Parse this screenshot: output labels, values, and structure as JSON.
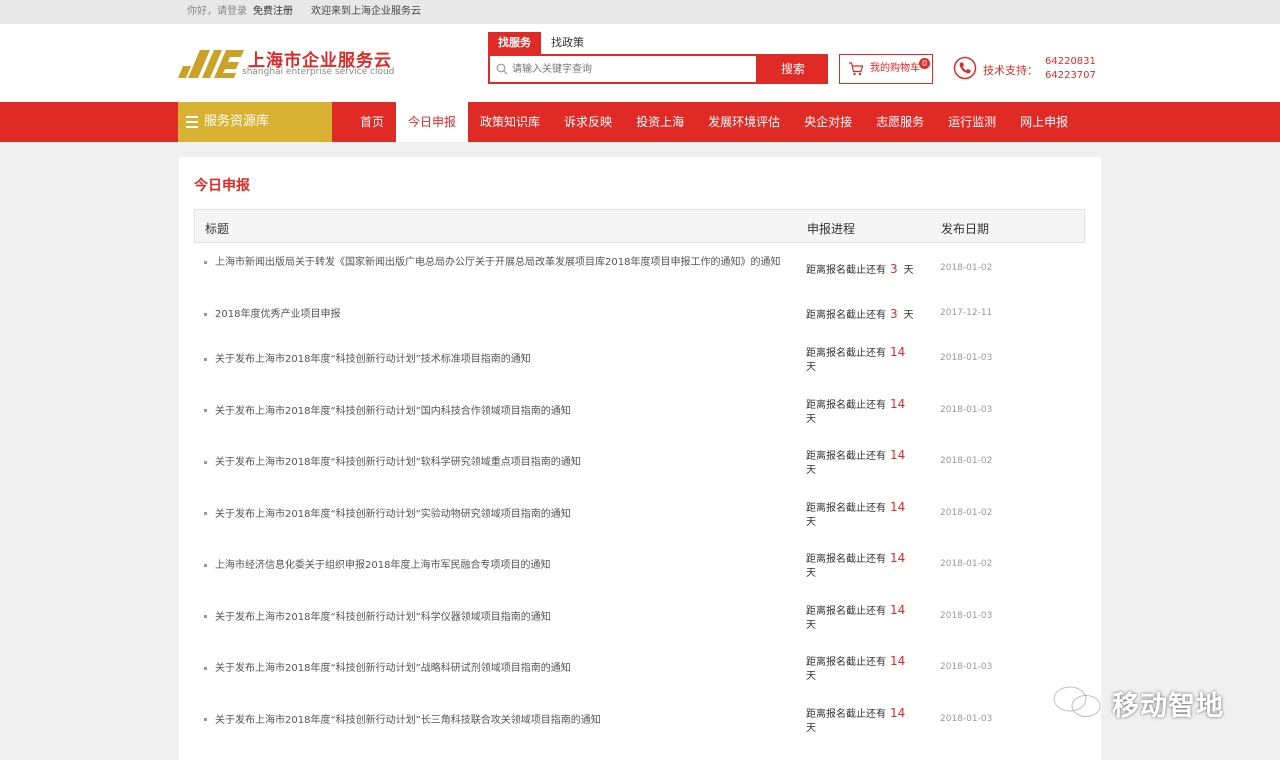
{
  "topbar": {
    "greeting": "你好，请登录",
    "register": "免费注册",
    "welcome": "欢迎来到上海企业服务云"
  },
  "header": {
    "logo_title": "上海市企业服务云",
    "logo_sub": "shanghai enterprise service cloud",
    "search_tabs": [
      "找服务",
      "找政策"
    ],
    "search_placeholder": "请输入关键字查询",
    "search_button": "搜索",
    "cart_label": "我的购物车",
    "cart_count": "0",
    "support_label": "技术支持：",
    "phones": [
      "64220831",
      "64223707"
    ]
  },
  "nav": {
    "resource_label": "服务资源库",
    "items": [
      "首页",
      "今日申报",
      "政策知识库",
      "诉求反映",
      "投资上海",
      "发展环境评估",
      "央企对接",
      "志愿服务",
      "运行监测",
      "网上申报"
    ],
    "active": "今日申报"
  },
  "main": {
    "page_title": "今日申报",
    "columns": [
      "标题",
      "申报进程",
      "发布日期"
    ],
    "rows": [
      {
        "title": "上海市新闻出版局关于转发《国家新闻出版广电总局办公厅关于开展总局改革发展项目库2018年度项目申报工作的通知》的通知",
        "prog_prefix": "距离报名截止还有",
        "days": "3",
        "unit": "天",
        "date": "2018-01-02"
      },
      {
        "title": "2018年度优秀产业项目申报",
        "prog_prefix": "距离报名截止还有",
        "days": "3",
        "unit": "天",
        "date": "2017-12-11"
      },
      {
        "title": "关于发布上海市2018年度“科技创新行动计划”技术标准项目指南的通知",
        "prog_prefix": "距离报名截止还有",
        "days": "14",
        "unit": "天",
        "date": "2018-01-03"
      },
      {
        "title": "关于发布上海市2018年度“科技创新行动计划”国内科技合作领域项目指南的通知",
        "prog_prefix": "距离报名截止还有",
        "days": "14",
        "unit": "天",
        "date": "2018-01-03"
      },
      {
        "title": "关于发布上海市2018年度“科技创新行动计划”软科学研究领域重点项目指南的通知",
        "prog_prefix": "距离报名截止还有",
        "days": "14",
        "unit": "天",
        "date": "2018-01-02"
      },
      {
        "title": "关于发布上海市2018年度“科技创新行动计划”实验动物研究领域项目指南的通知",
        "prog_prefix": "距离报名截止还有",
        "days": "14",
        "unit": "天",
        "date": "2018-01-02"
      },
      {
        "title": "上海市经济信息化委关于组织申报2018年度上海市军民融合专项项目的通知",
        "prog_prefix": "距离报名截止还有",
        "days": "14",
        "unit": "天",
        "date": "2018-01-02"
      },
      {
        "title": "关于发布上海市2018年度“科技创新行动计划”科学仪器领域项目指南的通知",
        "prog_prefix": "距离报名截止还有",
        "days": "14",
        "unit": "天",
        "date": "2018-01-03"
      },
      {
        "title": "关于发布上海市2018年度“科技创新行动计划”战略科研试剂领域项目指南的通知",
        "prog_prefix": "距离报名截止还有",
        "days": "14",
        "unit": "天",
        "date": "2018-01-03"
      },
      {
        "title": "关于发布上海市2018年度“科技创新行动计划”长三角科技联合攻关领域项目指南的通知",
        "prog_prefix": "距离报名截止还有",
        "days": "14",
        "unit": "天",
        "date": "2018-01-03"
      }
    ]
  },
  "watermark": {
    "text": "移动智地"
  },
  "colors": {
    "brand_red": "#e02a26",
    "gold": "#d9b233"
  }
}
